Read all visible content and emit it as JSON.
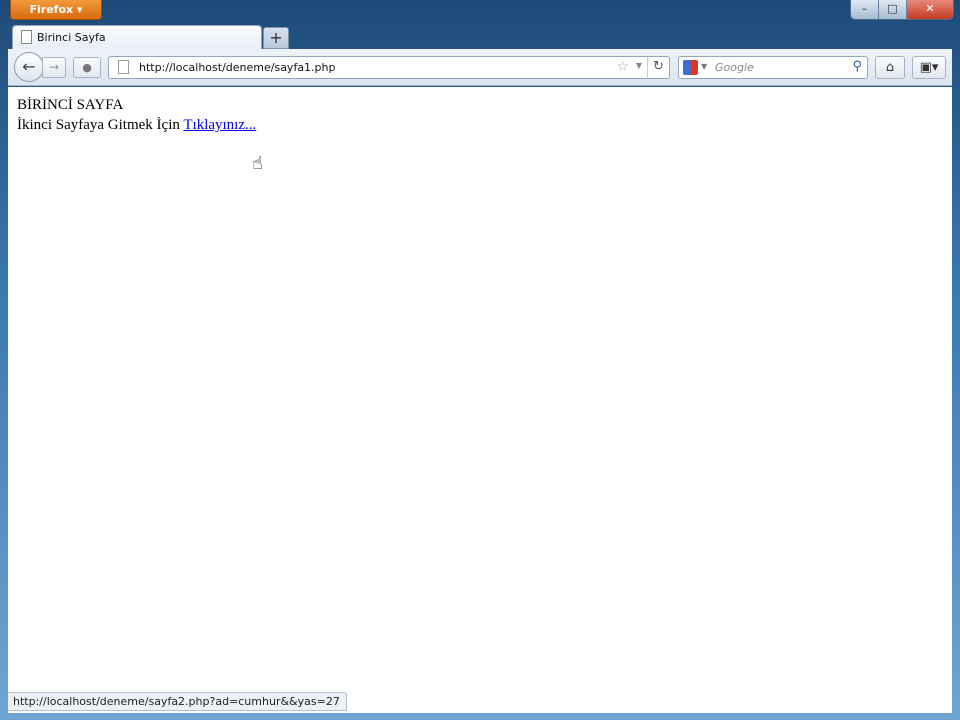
{
  "browser": {
    "menu_label": "Firefox ▾",
    "window_controls": {
      "minimize": "–",
      "maximize": "□",
      "close": "✕"
    }
  },
  "tabs": [
    {
      "label": "Birinci Sayfa",
      "active": true
    }
  ],
  "new_tab_label": "+",
  "navigation": {
    "url": "http://localhost/deneme/sayfa1.php",
    "search_placeholder": "Google"
  },
  "page": {
    "heading": "BİRİNCİ SAYFA",
    "text": "İkinci Sayfaya Gitmek İçin",
    "link_label": "Tıklayınız..."
  },
  "status_bar": {
    "text": "http://localhost/deneme/sayfa2.php?ad=cumhur&&yas=27"
  }
}
